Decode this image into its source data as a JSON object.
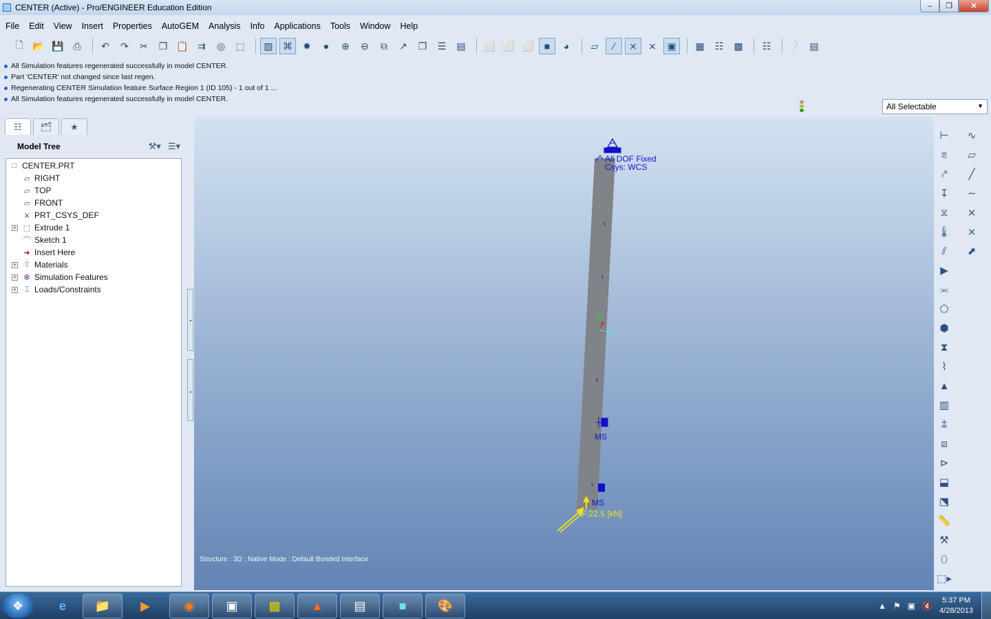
{
  "window": {
    "title": "CENTER (Active) - Pro/ENGINEER Education Edition",
    "minimize_icon": "minimize-icon",
    "maximize_icon": "restore-icon",
    "close_icon": "close-icon"
  },
  "menu": [
    "File",
    "Edit",
    "View",
    "Insert",
    "Properties",
    "AutoGEM",
    "Analysis",
    "Info",
    "Applications",
    "Tools",
    "Window",
    "Help"
  ],
  "messages": [
    "All Simulation features regenerated successfully in model CENTER.",
    "Part 'CENTER' not changed since last regen.",
    "Regenerating CENTER Simulation feature  Surface Region 1 (ID 105) - 1 out of 1 ...",
    "All Simulation features regenerated successfully in model CENTER."
  ],
  "filter": {
    "value": "All Selectable"
  },
  "model_tree": {
    "title": "Model Tree",
    "items": [
      {
        "label": "CENTER.PRT",
        "icon": "part-icon"
      },
      {
        "label": "RIGHT",
        "icon": "datum-plane-icon"
      },
      {
        "label": "TOP",
        "icon": "datum-plane-icon"
      },
      {
        "label": "FRONT",
        "icon": "datum-plane-icon"
      },
      {
        "label": "PRT_CSYS_DEF",
        "icon": "csys-icon"
      },
      {
        "label": "Extrude 1",
        "icon": "extrude-icon"
      },
      {
        "label": "Sketch 1",
        "icon": "sketch-icon"
      },
      {
        "label": "Insert Here",
        "icon": "insert-here-icon"
      },
      {
        "label": "Materials",
        "icon": "materials-icon"
      },
      {
        "label": "Simulation Features",
        "icon": "simulation-icon"
      },
      {
        "label": "Loads/Constraints",
        "icon": "loads-icon"
      }
    ]
  },
  "graphics": {
    "constraint_label_1": "All DOF Fixed",
    "constraint_label_2": "Csys: WCS",
    "ms_label_1": "MS",
    "ms_label_2": "MS",
    "force_label": "F:22.5 [kN]",
    "status": "Structure : 3D : Native Mode : Default Bonded Interface"
  },
  "taskbar": {
    "time": "5:37 PM",
    "date": "4/28/2013"
  },
  "colors": {
    "beam": "#808387",
    "constraint": "#1010c8",
    "force": "#f2e21a",
    "graphics_top": "#d3e2f1",
    "graphics_bottom": "#6384b5"
  }
}
